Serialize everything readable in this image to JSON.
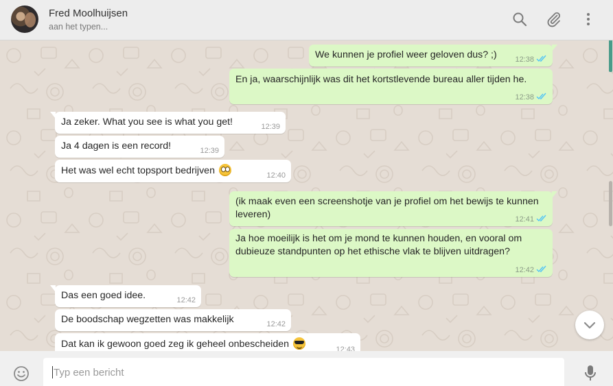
{
  "header": {
    "contact_name": "Fred Moolhuijsen",
    "status": "aan het typen...",
    "icons": [
      "search-icon",
      "attach-icon",
      "menu-icon"
    ]
  },
  "messages": [
    {
      "dir": "out",
      "text": "We kunnen je profiel weer geloven dus? ;)",
      "time": "12:38",
      "ticks": "read"
    },
    {
      "dir": "out",
      "text": "En ja, waarschijnlijk was dit het kortstlevende bureau aller tijden he.",
      "time": "12:38",
      "ticks": "read"
    },
    {
      "dir": "in",
      "text": "Ja zeker. What you see is what you get!",
      "time": "12:39"
    },
    {
      "dir": "in",
      "text": "Ja 4 dagen is een record!",
      "time": "12:39"
    },
    {
      "dir": "in",
      "text": "Het was wel echt topsport bedrijven",
      "emoji": "face-with-rolling-eyes",
      "time": "12:40"
    },
    {
      "dir": "out",
      "text": "(ik maak even een screenshotje van je profiel om het bewijs te kunnen leveren)",
      "time": "12:41",
      "ticks": "read"
    },
    {
      "dir": "out",
      "text": "Ja hoe moeilijk is het om je mond te kunnen houden, en vooral om dubieuze standpunten op het ethische vlak te blijven uitdragen?",
      "time": "12:42",
      "ticks": "read"
    },
    {
      "dir": "in",
      "text": "Das een goed idee.",
      "time": "12:42"
    },
    {
      "dir": "in",
      "text": "De boodschap wegzetten was makkelijk",
      "time": "12:42"
    },
    {
      "dir": "in",
      "text": "Dat kan ik gewoon goed zeg ik geheel onbescheiden",
      "emoji": "smiling-face-with-sunglasses",
      "time": "12:43"
    }
  ],
  "footer": {
    "input_placeholder": "Typ een bericht",
    "icons": [
      "emoji-icon",
      "microphone-icon"
    ]
  },
  "colors": {
    "header_bg": "#ededed",
    "chat_bg": "#e5ddd5",
    "outgoing_bubble": "#dcf8c6",
    "incoming_bubble": "#ffffff",
    "read_ticks": "#4fc3f7"
  }
}
